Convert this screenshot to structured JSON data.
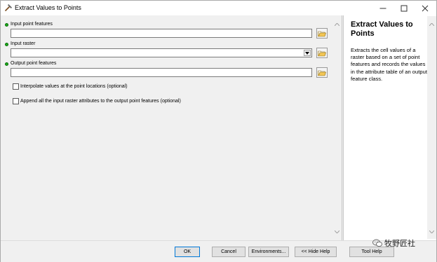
{
  "window": {
    "title": "Extract Values to Points",
    "title_icon": "hammer-icon",
    "controls": [
      "minimize-icon",
      "maximize-icon",
      "close-icon"
    ]
  },
  "form": {
    "fields": [
      {
        "label": "Input point features",
        "required": true,
        "value": "",
        "type": "text"
      },
      {
        "label": "Input raster",
        "required": true,
        "value": "",
        "type": "combo"
      },
      {
        "label": "Output point features",
        "required": true,
        "value": "",
        "type": "text"
      }
    ],
    "options": [
      {
        "label": "Interpolate values at the point locations (optional)",
        "checked": false
      },
      {
        "label": "Append all the input raster attributes to the output point features (optional)",
        "checked": false
      }
    ],
    "required_color": "#1aa81a"
  },
  "help": {
    "title": "Extract Values to Points",
    "body": "Extracts the cell values of a raster based on a set of point features and records the values in the attribute table of an output feature class."
  },
  "buttons": {
    "ok": "OK",
    "cancel": "Cancel",
    "environments": "Environments...",
    "hide_help": "<< Hide Help",
    "tool_help": "Tool Help"
  },
  "watermark": {
    "text": "牧野匠社",
    "icon": "wechat-icon"
  }
}
